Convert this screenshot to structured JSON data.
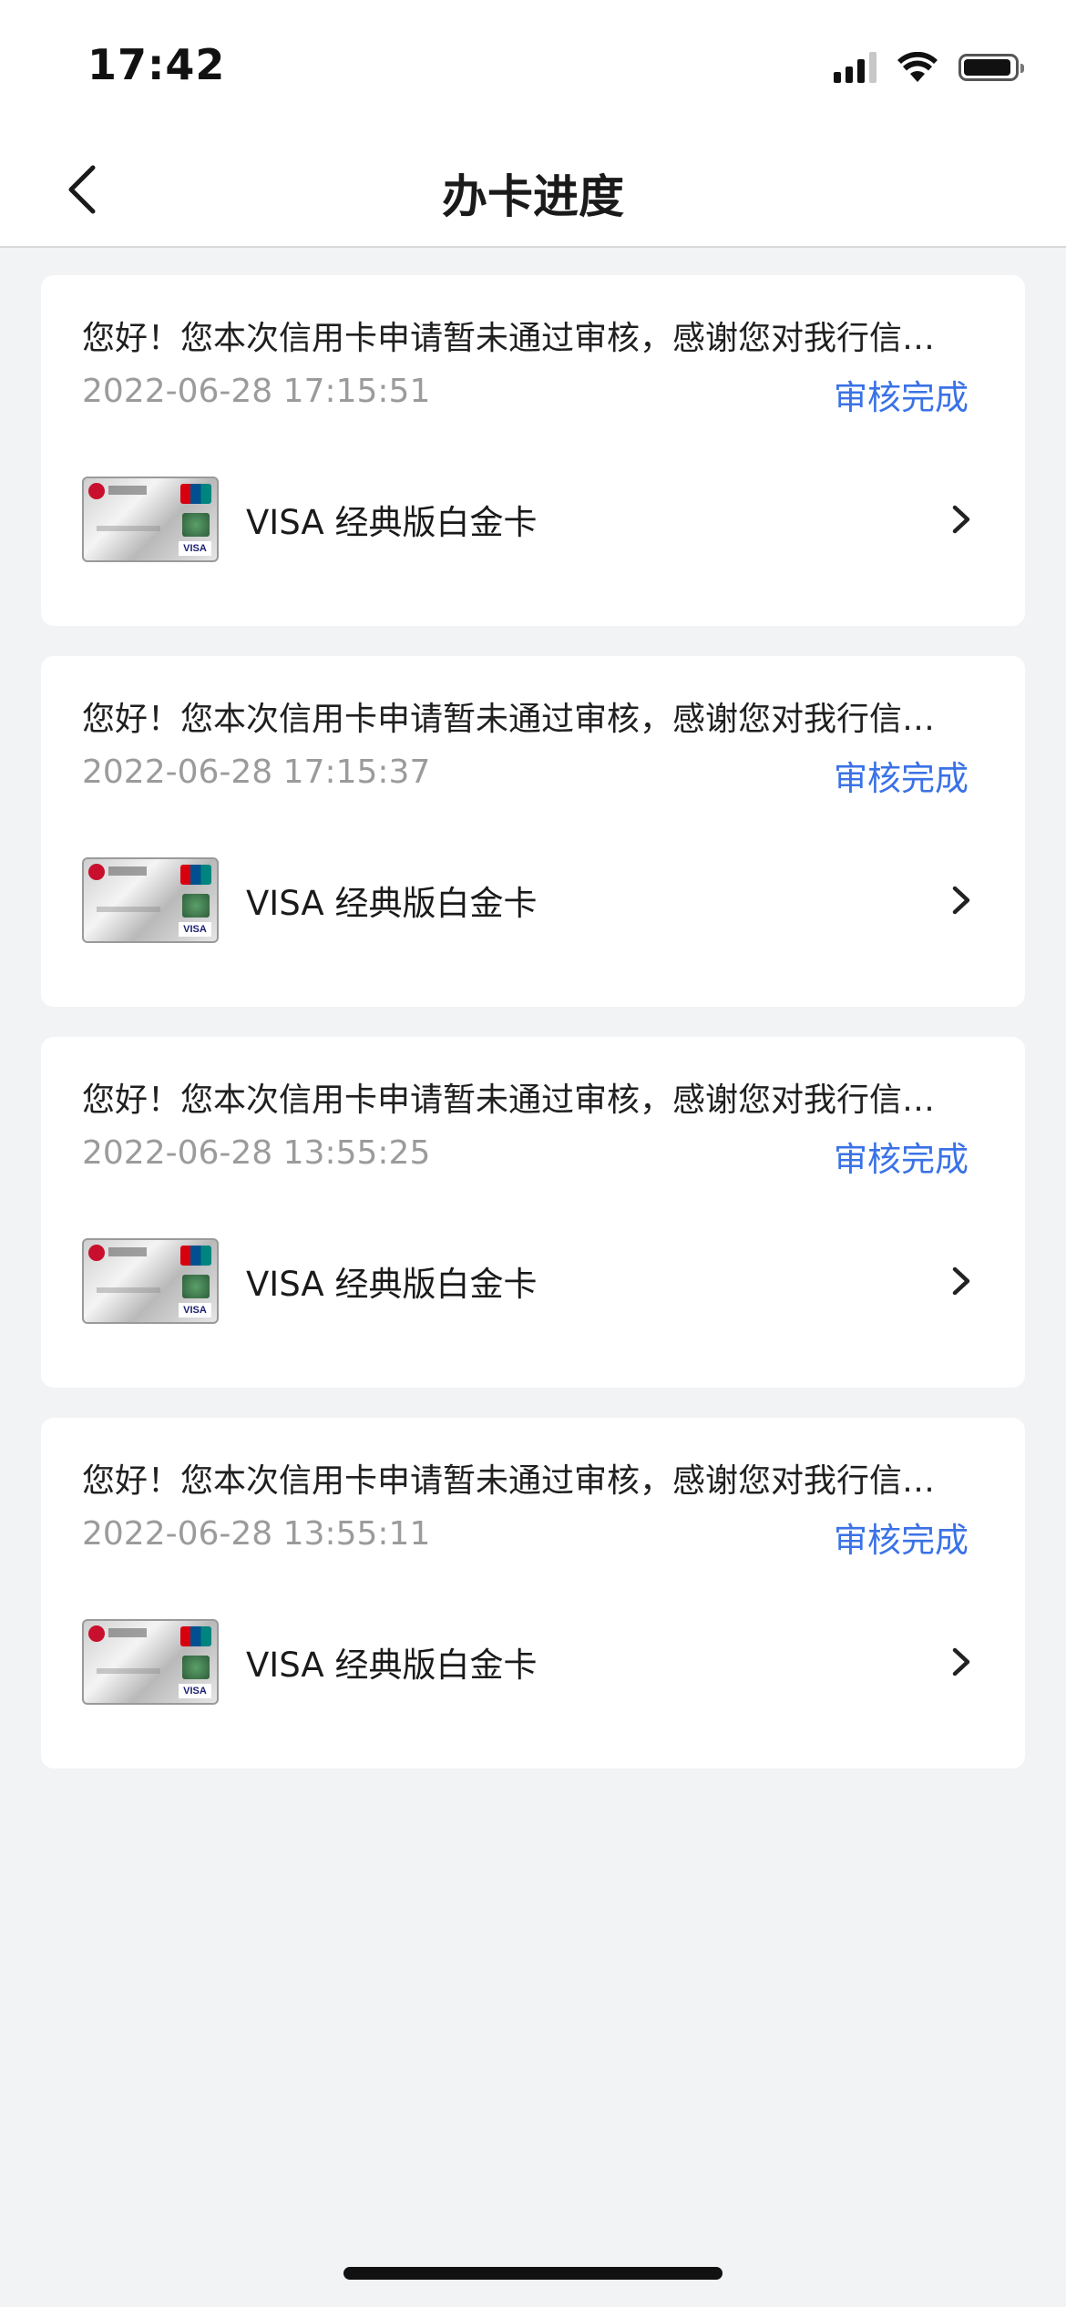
{
  "status_bar": {
    "time": "17:42"
  },
  "nav": {
    "title": "办卡进度"
  },
  "cards": [
    {
      "message": "您好！您本次信用卡申请暂未通过审核，感谢您对我行信…",
      "datetime": "2022-06-28 17:15:51",
      "status": "审核完成",
      "product": "VISA 经典版白金卡"
    },
    {
      "message": "您好！您本次信用卡申请暂未通过审核，感谢您对我行信…",
      "datetime": "2022-06-28 17:15:37",
      "status": "审核完成",
      "product": "VISA 经典版白金卡"
    },
    {
      "message": "您好！您本次信用卡申请暂未通过审核，感谢您对我行信…",
      "datetime": "2022-06-28 13:55:25",
      "status": "审核完成",
      "product": "VISA 经典版白金卡"
    },
    {
      "message": "您好！您本次信用卡申请暂未通过审核，感谢您对我行信…",
      "datetime": "2022-06-28 13:55:11",
      "status": "审核完成",
      "product": "VISA 经典版白金卡"
    }
  ],
  "card_thumb_label": "VISA",
  "colors": {
    "accent": "#3a72e6",
    "timestamp": "#9b9b9b",
    "background": "#f2f3f5"
  },
  "icons": {
    "back": "chevron-left-icon",
    "row_arrow": "chevron-right-icon",
    "signal": "cellular-signal-icon",
    "wifi": "wifi-icon",
    "battery": "battery-icon"
  }
}
